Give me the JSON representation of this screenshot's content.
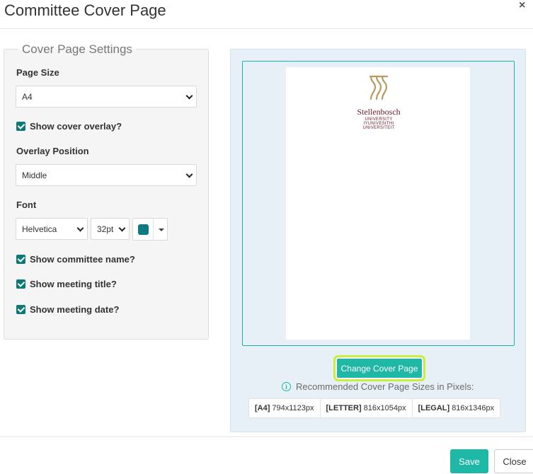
{
  "modal": {
    "title": "Committee Cover Page",
    "close_glyph": "×"
  },
  "settings": {
    "legend": "Cover Page Settings",
    "page_size_label": "Page Size",
    "page_size_value": "A4",
    "show_overlay_label": "Show cover overlay?",
    "show_overlay_checked": true,
    "overlay_position_label": "Overlay Position",
    "overlay_position_value": "Middle",
    "font_label": "Font",
    "font_family_value": "Helvetica",
    "font_size_value": "32pt",
    "font_color": "#0b7a85",
    "show_committee_label": "Show committee name?",
    "show_meeting_title_label": "Show meeting title?",
    "show_meeting_date_label": "Show meeting date?"
  },
  "preview": {
    "logo": {
      "brand": "Stellenbosch",
      "lines": [
        "UNIVERSITY",
        "IYUNIVESITHI",
        "UNIVERSITEIT"
      ],
      "gold": "#b89a5f",
      "maroon": "#6b1b2a"
    },
    "change_button": "Change Cover Page",
    "recommended_text": "Recommended Cover Page Sizes in Pixels:",
    "sizes": [
      {
        "tag": "[A4]",
        "value": "794x1123px"
      },
      {
        "tag": "[LETTER]",
        "value": "816x1054px"
      },
      {
        "tag": "[LEGAL]",
        "value": "816x1346px"
      }
    ]
  },
  "footer": {
    "save_label": "Save",
    "close_label": "Close"
  },
  "colors": {
    "accent": "#1fb7a6",
    "checkbox": "#0b7a75",
    "focus_ring": "#c8f03a"
  }
}
